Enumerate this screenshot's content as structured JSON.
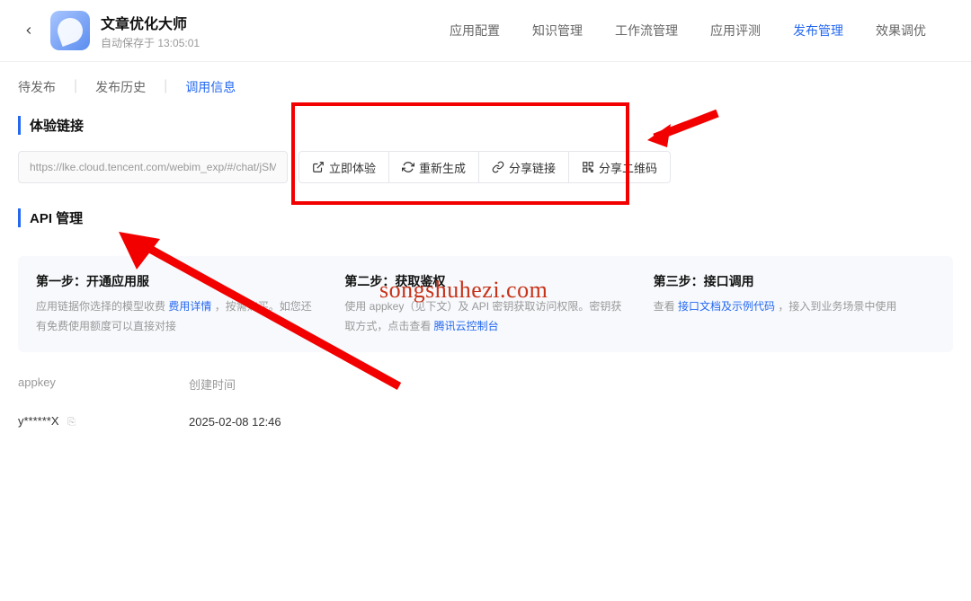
{
  "header": {
    "title": "文章优化大师",
    "subtitle": "自动保存于 13:05:01"
  },
  "nav": [
    "应用配置",
    "知识管理",
    "工作流管理",
    "应用评测",
    "发布管理",
    "效果调优"
  ],
  "nav_active": "发布管理",
  "sub_tabs": [
    "待发布",
    "发布历史",
    "调用信息"
  ],
  "sub_active": "调用信息",
  "section_link": {
    "title": "体验链接",
    "url": "https://lke.cloud.tencent.com/webim_exp/#/chat/jSMoNG",
    "btns": [
      "立即体验",
      "重新生成",
      "分享链接",
      "分享二维码"
    ]
  },
  "section_api": {
    "title": "API 管理",
    "steps": [
      {
        "title": "第一步：开通应用服",
        "desc_pre": "应用链据你选择的模型收费",
        "desc_link": "费用详情",
        "desc_post": "，按需购买。如您还有免费使用额度可以直接对接"
      },
      {
        "title": "第二步：获取鉴权",
        "desc_pre": "使用 appkey（见下文）及 API 密钥获取访问权限。密钥获取方式，点击查看 ",
        "desc_link": "腾讯云控制台",
        "desc_post": ""
      },
      {
        "title": "第三步：接口调用",
        "desc_pre": "查看",
        "desc_link": "接口文档及示例代码",
        "desc_post": "，接入到业务场景中使用"
      }
    ],
    "table_headers": [
      "appkey",
      "创建时间"
    ],
    "table_row": {
      "key": "y******X",
      "time": "2025-02-08 12:46"
    }
  },
  "watermark": "songshuhezi.com"
}
